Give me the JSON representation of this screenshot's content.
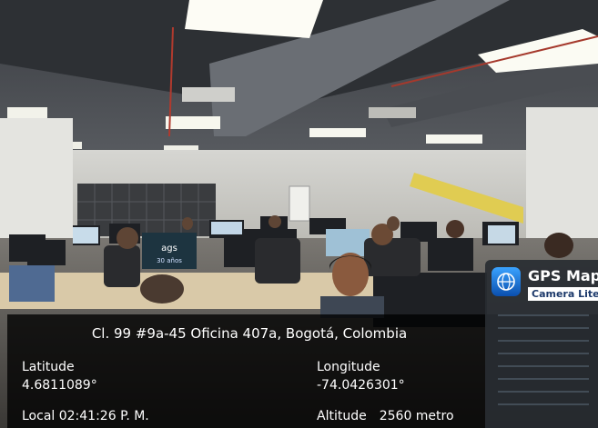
{
  "photo": {
    "monitor_brand_text": "ags",
    "monitor_sub_text": "30 años"
  },
  "overlay": {
    "address": "Cl. 99 #9a-45 Oficina 407a, Bogotá, Colombia",
    "latitude_label": "Latitude",
    "latitude_value": "4.6811089°",
    "longitude_label": "Longitude",
    "longitude_value": "-74.0426301°",
    "local_time": "Local 02:41:26 P. M.",
    "altitude_label": "Altitude",
    "altitude_value": "2560 metro"
  },
  "badge": {
    "title": "GPS Map",
    "subtitle": "Camera Lite",
    "icon": "globe-icon"
  }
}
